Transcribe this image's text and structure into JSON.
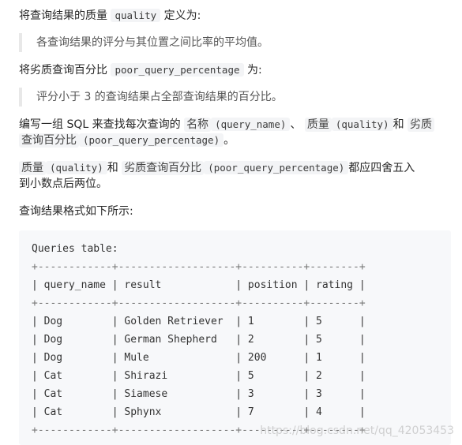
{
  "paragraphs": {
    "p1_prefix": "将查询结果的质量",
    "p1_code": "quality",
    "p1_suffix": "定义为:",
    "q1": "各查询结果的评分与其位置之间比率的平均值。",
    "p2_prefix": "将劣质查询百分比",
    "p2_code": "poor_query_percentage",
    "p2_suffix": "为:",
    "q2": "评分小于 3 的查询结果占全部查询结果的百分比。",
    "p3_a": "编写一组 SQL 来查找每次查询的",
    "p3_k1": "名称",
    "p3_c1": "(query_name)",
    "p3_sep": "、",
    "p3_k2": "质量",
    "p3_c2": "(quality)",
    "p3_and": "和",
    "p3_k3": "劣质",
    "p3_line2_k": "查询百分比",
    "p3_line2_c": "(poor_query_percentage)",
    "p3_line2_end": "。",
    "p4_k1": "质量",
    "p4_c1": "(quality)",
    "p4_and": "和",
    "p4_k2": "劣质查询百分比",
    "p4_c2": "(poor_query_percentage)",
    "p4_suffix": "都应四舍五入",
    "p4_line2": "到小数点后两位。",
    "p5": "查询结果格式如下所示:"
  },
  "code_block": {
    "title": "Queries table:",
    "border": "+------------+-------------------+----------+--------+",
    "header": "| query_name | result            | position | rating |",
    "rows": [
      "| Dog        | Golden Retriever  | 1        | 5      |",
      "| Dog        | German Shepherd   | 2        | 5      |",
      "| Dog        | Mule              | 200      | 1      |",
      "| Cat        | Shirazi           | 5        | 2      |",
      "| Cat        | Siamese           | 3        | 3      |",
      "| Cat        | Sphynx            | 7        | 4      |"
    ],
    "table": {
      "columns": [
        "query_name",
        "result",
        "position",
        "rating"
      ],
      "data": [
        [
          "Dog",
          "Golden Retriever",
          "1",
          "5"
        ],
        [
          "Dog",
          "German Shepherd",
          "2",
          "5"
        ],
        [
          "Dog",
          "Mule",
          "200",
          "1"
        ],
        [
          "Cat",
          "Shirazi",
          "5",
          "2"
        ],
        [
          "Cat",
          "Siamese",
          "3",
          "3"
        ],
        [
          "Cat",
          "Sphynx",
          "7",
          "4"
        ]
      ]
    }
  },
  "watermark": "https://blog.csdn.net/qq_42053453"
}
